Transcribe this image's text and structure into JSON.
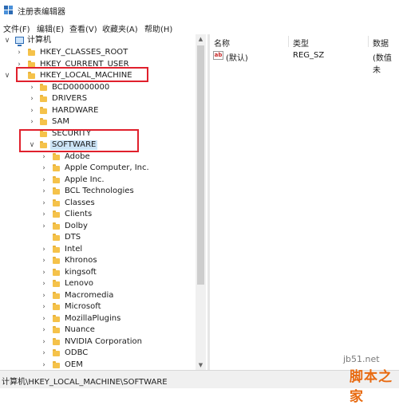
{
  "window": {
    "title": "注册表编辑器"
  },
  "menu": [
    {
      "label": "文件(F)"
    },
    {
      "label": "编辑(E)"
    },
    {
      "label": "查看(V)"
    },
    {
      "label": "收藏夹(A)"
    },
    {
      "label": "帮助(H)"
    }
  ],
  "tree": {
    "root": {
      "label": "计算机",
      "expanded": true
    },
    "hives": [
      {
        "label": "HKEY_CLASSES_ROOT",
        "expanded": false
      },
      {
        "label": "HKEY_CURRENT_USER",
        "expanded": false
      },
      {
        "label": "HKEY_LOCAL_MACHINE",
        "expanded": true
      }
    ],
    "hklm_children": [
      {
        "label": "BCD00000000",
        "expanded": false
      },
      {
        "label": "DRIVERS",
        "expanded": false
      },
      {
        "label": "HARDWARE",
        "expanded": false
      },
      {
        "label": "SAM",
        "expanded": false
      },
      {
        "label": "SECURITY",
        "expanded": false
      },
      {
        "label": "SOFTWARE",
        "expanded": true,
        "selected": true
      }
    ],
    "software_children": [
      {
        "label": "Adobe"
      },
      {
        "label": "Apple Computer, Inc."
      },
      {
        "label": "Apple Inc."
      },
      {
        "label": "BCL Technologies"
      },
      {
        "label": "Classes"
      },
      {
        "label": "Clients"
      },
      {
        "label": "Dolby"
      },
      {
        "label": "DTS",
        "has_children": false
      },
      {
        "label": "Intel"
      },
      {
        "label": "Khronos"
      },
      {
        "label": "kingsoft"
      },
      {
        "label": "Lenovo"
      },
      {
        "label": "Macromedia"
      },
      {
        "label": "Microsoft"
      },
      {
        "label": "MozillaPlugins"
      },
      {
        "label": "Nuance"
      },
      {
        "label": "NVIDIA Corporation"
      },
      {
        "label": "ODBC"
      },
      {
        "label": "OEM"
      }
    ]
  },
  "list": {
    "columns": [
      "名称",
      "类型",
      "数据"
    ],
    "rows": [
      {
        "icon": "string-value-icon",
        "icon_text": "ab",
        "name": "(默认)",
        "type": "REG_SZ",
        "data": "(数值未"
      }
    ]
  },
  "status": {
    "path": "计算机\\HKEY_LOCAL_MACHINE\\SOFTWARE"
  },
  "watermark": {
    "url": "jb51.net",
    "logo": "脚本之家"
  },
  "colors": {
    "highlight": "#e0202c",
    "folder": "#f5c24a",
    "selection": "#cce4f7"
  }
}
